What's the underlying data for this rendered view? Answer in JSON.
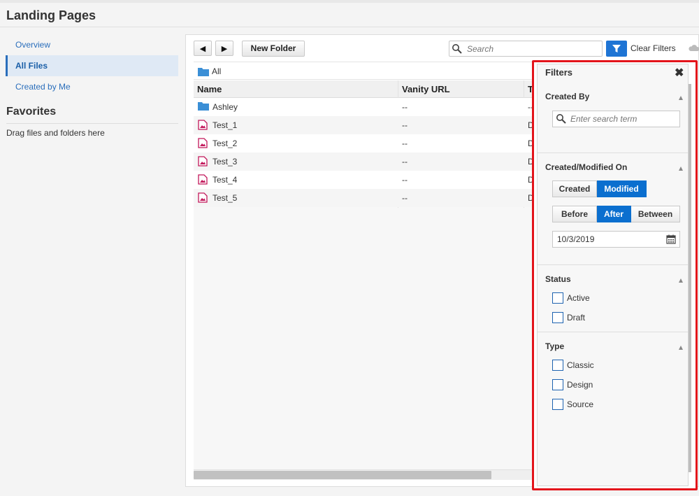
{
  "page": {
    "title": "Landing Pages"
  },
  "nav": {
    "items": [
      {
        "label": "Overview",
        "active": false
      },
      {
        "label": "All Files",
        "active": true
      },
      {
        "label": "Created by Me",
        "active": false
      }
    ]
  },
  "favorites": {
    "title": "Favorites",
    "hint": "Drag files and folders here"
  },
  "toolbar": {
    "back_icon": "left-arrow-icon",
    "forward_icon": "right-arrow-icon",
    "new_folder_label": "New Folder",
    "search_placeholder": "Search",
    "filter_icon": "funnel-icon",
    "clear_filters_label": "Clear Filters"
  },
  "breadcrumb": {
    "label": "All"
  },
  "table": {
    "columns": [
      "Name",
      "Vanity URL",
      "Ty"
    ],
    "rows": [
      {
        "name": "Ashley",
        "vanity": "--",
        "type": "--",
        "icon": "folder-icon"
      },
      {
        "name": "Test_1",
        "vanity": "--",
        "type": "De",
        "icon": "page-icon"
      },
      {
        "name": "Test_2",
        "vanity": "--",
        "type": "De",
        "icon": "page-icon"
      },
      {
        "name": "Test_3",
        "vanity": "--",
        "type": "De",
        "icon": "page-icon"
      },
      {
        "name": "Test_4",
        "vanity": "--",
        "type": "De",
        "icon": "page-icon"
      },
      {
        "name": "Test_5",
        "vanity": "--",
        "type": "De",
        "icon": "page-icon"
      }
    ]
  },
  "filters": {
    "title": "Filters",
    "close_icon": "close-icon",
    "created_by": {
      "title": "Created By",
      "search_placeholder": "Enter search term"
    },
    "created_modified": {
      "title": "Created/Modified On",
      "mode_options": [
        "Created",
        "Modified"
      ],
      "mode_selected": "Modified",
      "range_options": [
        "Before",
        "After",
        "Between"
      ],
      "range_selected": "After",
      "date": "10/3/2019"
    },
    "status": {
      "title": "Status",
      "options": [
        "Active",
        "Draft"
      ]
    },
    "type": {
      "title": "Type",
      "options": [
        "Classic",
        "Design",
        "Source"
      ]
    }
  },
  "colors": {
    "accent": "#0b6fcf",
    "highlight_border": "#e3141b",
    "link": "#2a6ebb",
    "page_icon": "#c2185b",
    "folder_icon": "#3b8fd6"
  }
}
